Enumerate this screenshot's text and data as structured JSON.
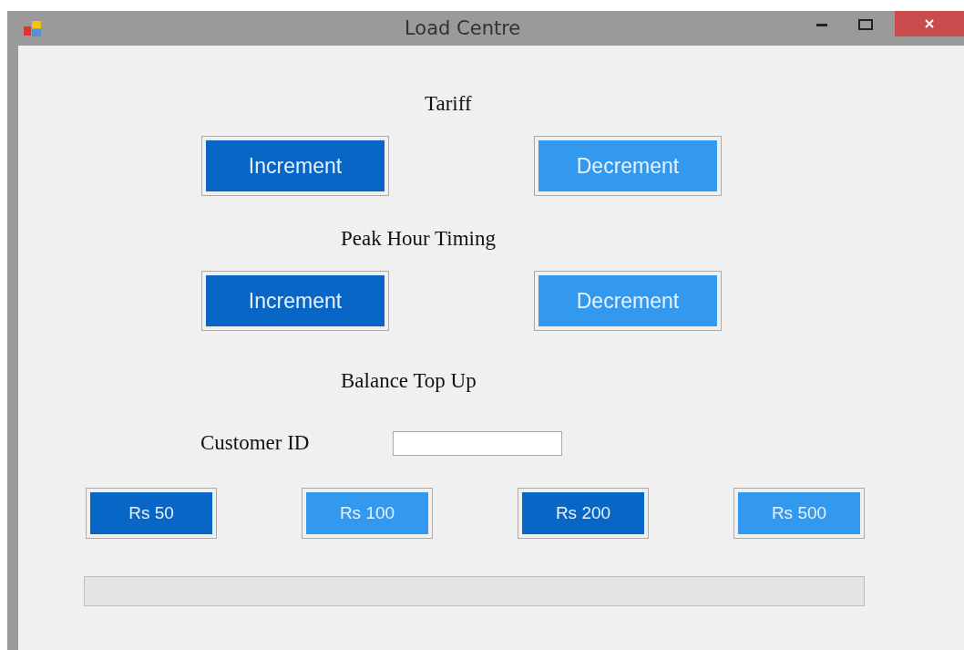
{
  "window": {
    "title": "Load Centre"
  },
  "tariff": {
    "heading": "Tariff",
    "buttons": [
      {
        "label": "Increment",
        "color": "#0866c6"
      },
      {
        "label": "Decrement",
        "color": "#3399ee"
      }
    ]
  },
  "peak_hour": {
    "heading": "Peak Hour Timing",
    "buttons": [
      {
        "label": "Increment",
        "color": "#0866c6"
      },
      {
        "label": "Decrement",
        "color": "#3399ee"
      }
    ]
  },
  "top_up": {
    "heading": "Balance Top Up",
    "customer_id_label": "Customer ID",
    "amounts": [
      {
        "label": "Rs 50",
        "color": "#0866c6"
      },
      {
        "label": "Rs 100",
        "color": "#3399ee"
      },
      {
        "label": "Rs 200",
        "color": "#0866c6"
      },
      {
        "label": "Rs 500",
        "color": "#3399ee"
      }
    ]
  },
  "progress": {
    "level": 0
  }
}
